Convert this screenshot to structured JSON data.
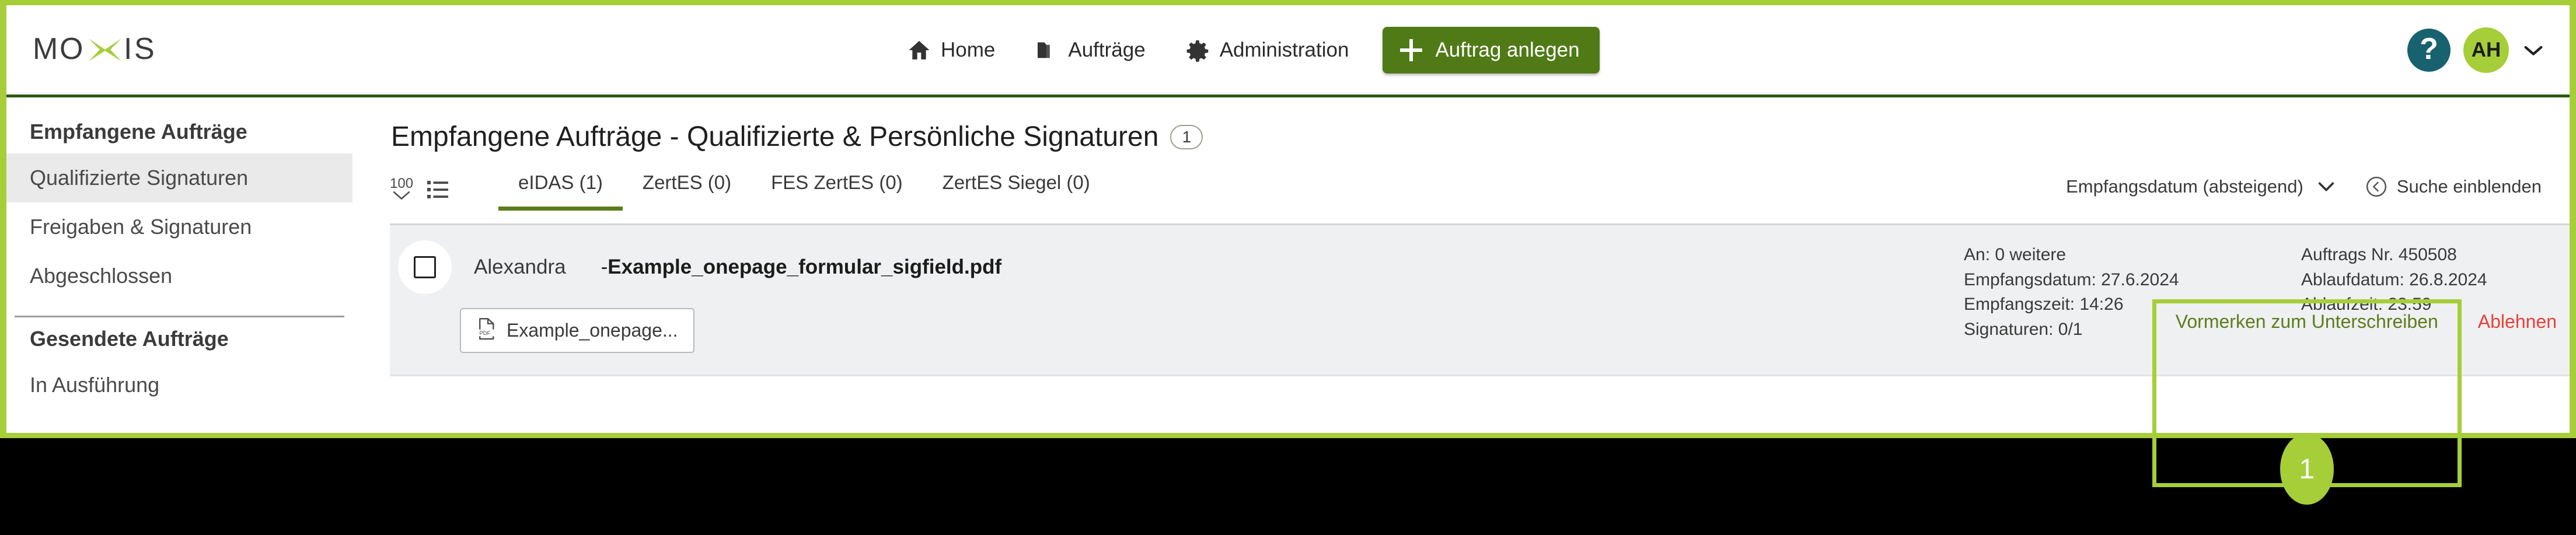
{
  "brand": {
    "logo_text": "MOXIS",
    "accent_green": "#a6ce39",
    "dark_green": "#4f7a16",
    "teal": "#17626e",
    "danger_red": "#e8403a"
  },
  "header": {
    "nav": [
      {
        "label": "Home",
        "icon": "home-icon"
      },
      {
        "label": "Aufträge",
        "icon": "folder-icon"
      },
      {
        "label": "Administration",
        "icon": "gear-icon"
      }
    ],
    "create_button": {
      "label": "Auftrag anlegen",
      "icon": "plus-icon"
    },
    "help_icon": "question-mark-icon",
    "avatar_initials": "AH",
    "user_menu_icon": "chevron-down-icon"
  },
  "sidebar": {
    "groups": [
      {
        "title": "Empfangene Aufträge",
        "items": [
          {
            "label": "Qualifizierte Signaturen",
            "active": true
          },
          {
            "label": "Freigaben & Signaturen",
            "active": false
          },
          {
            "label": "Abgeschlossen",
            "active": false
          }
        ]
      },
      {
        "title": "Gesendete Aufträge",
        "items": [
          {
            "label": "In Ausführung",
            "active": false
          }
        ]
      }
    ]
  },
  "main": {
    "page_title": "Empfangene Aufträge - Qualifizierte & Persönliche Signaturen",
    "page_count_badge": "1",
    "toolbar": {
      "page_size": "100",
      "page_size_icon": "chevron-down-icon",
      "list_view_icon": "list-view-icon",
      "sort_label": "Empfangsdatum (absteigend)",
      "sort_icon": "chevron-down-icon",
      "search_label": "Suche einblenden",
      "search_icon": "circle-chevron-left-icon"
    },
    "tabs": [
      {
        "label": "eIDAS (1)",
        "active": true
      },
      {
        "label": "ZertES (0)",
        "active": false
      },
      {
        "label": "FES ZertES (0)",
        "active": false
      },
      {
        "label": "ZertES Siegel (0)",
        "active": false
      }
    ],
    "row": {
      "checkbox_checked": false,
      "sender": "Alexandra",
      "separator": "-",
      "document_name": "Example_onepage_formular_sigfield.pdf",
      "attachment_chip": {
        "label": "Example_onepage...",
        "icon": "pdf-file-icon"
      },
      "meta_col1": [
        "An: 0 weitere",
        "Empfangsdatum: 27.6.2024",
        "Empfangszeit: 14:26",
        "Signaturen: 0/1"
      ],
      "meta_col2": [
        "Auftrags Nr. 450508",
        "Ablaufdatum: 26.8.2024",
        "Ablaufzeit: 23:59"
      ],
      "actions": [
        {
          "label": "Vormerken zum Unterschreiben",
          "style": "primary"
        },
        {
          "label": "Ablehnen",
          "style": "danger"
        }
      ]
    }
  },
  "annotation": {
    "badge_number": "1"
  }
}
